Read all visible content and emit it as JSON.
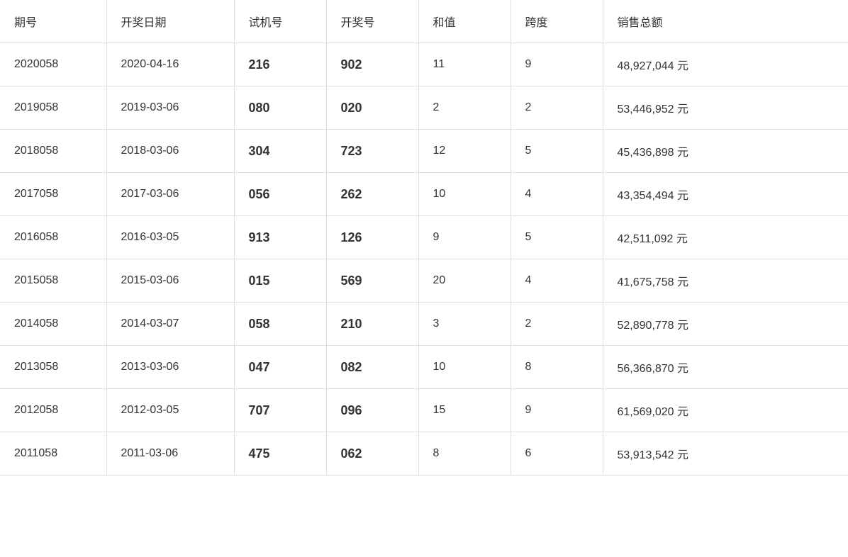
{
  "table": {
    "headers": [
      "期号",
      "开奖日期",
      "试机号",
      "开奖号",
      "和值",
      "跨度",
      "销售总额"
    ],
    "rows": [
      {
        "period": "2020058",
        "date": "2020-04-16",
        "trial": "216",
        "draw": "902",
        "sum": "11",
        "span": "9",
        "sales": "48,927,044 元"
      },
      {
        "period": "2019058",
        "date": "2019-03-06",
        "trial": "080",
        "draw": "020",
        "sum": "2",
        "span": "2",
        "sales": "53,446,952 元"
      },
      {
        "period": "2018058",
        "date": "2018-03-06",
        "trial": "304",
        "draw": "723",
        "sum": "12",
        "span": "5",
        "sales": "45,436,898 元"
      },
      {
        "period": "2017058",
        "date": "2017-03-06",
        "trial": "056",
        "draw": "262",
        "sum": "10",
        "span": "4",
        "sales": "43,354,494 元"
      },
      {
        "period": "2016058",
        "date": "2016-03-05",
        "trial": "913",
        "draw": "126",
        "sum": "9",
        "span": "5",
        "sales": "42,511,092 元"
      },
      {
        "period": "2015058",
        "date": "2015-03-06",
        "trial": "015",
        "draw": "569",
        "sum": "20",
        "span": "4",
        "sales": "41,675,758 元"
      },
      {
        "period": "2014058",
        "date": "2014-03-07",
        "trial": "058",
        "draw": "210",
        "sum": "3",
        "span": "2",
        "sales": "52,890,778 元"
      },
      {
        "period": "2013058",
        "date": "2013-03-06",
        "trial": "047",
        "draw": "082",
        "sum": "10",
        "span": "8",
        "sales": "56,366,870 元"
      },
      {
        "period": "2012058",
        "date": "2012-03-05",
        "trial": "707",
        "draw": "096",
        "sum": "15",
        "span": "9",
        "sales": "61,569,020 元"
      },
      {
        "period": "2011058",
        "date": "2011-03-06",
        "trial": "475",
        "draw": "062",
        "sum": "8",
        "span": "6",
        "sales": "53,913,542 元"
      }
    ]
  }
}
